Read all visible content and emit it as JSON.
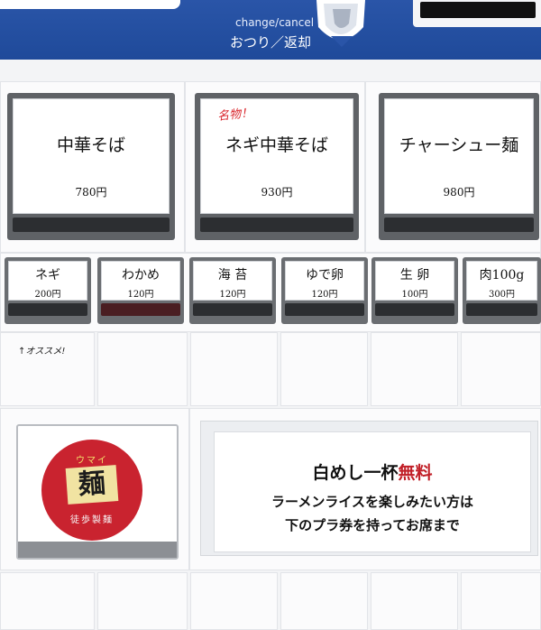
{
  "header": {
    "change_label": "change/cancel",
    "change_label_jp": "おつり／返却"
  },
  "main_items": [
    {
      "tag": "",
      "name": "中華そば",
      "price": "780円"
    },
    {
      "tag": "名物！",
      "name": "ネギ中華そば",
      "price": "930円"
    },
    {
      "tag": "",
      "name": "チャーシュー麺",
      "price": "980円"
    }
  ],
  "toppings": [
    {
      "name": "ネギ",
      "price": "200円"
    },
    {
      "name": "わかめ",
      "price": "120円"
    },
    {
      "name": "海 苔",
      "price": "120円"
    },
    {
      "name": "ゆで卵",
      "price": "120円"
    },
    {
      "name": "生 卵",
      "price": "100円"
    },
    {
      "name": "肉100g",
      "price": "300円"
    }
  ],
  "handwritten_note": "↑オススメ!",
  "noodle_sign": {
    "top_text": "ウマイ",
    "main_text": "麺",
    "bottom_text": "徒歩製麺"
  },
  "notice": {
    "title_prefix": "白めし一杯",
    "title_highlight": "無料",
    "line1": "ラーメンライスを楽しみたい方は",
    "line2": "下のプラ券を持ってお席まで"
  },
  "colors": {
    "panel_blue": "#2a55a8",
    "accent_red": "#c11f27"
  }
}
